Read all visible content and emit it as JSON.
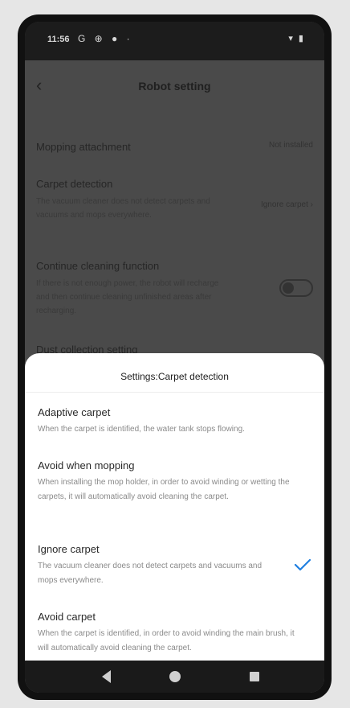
{
  "status_bar": {
    "time": "11:56",
    "left_icons": "G ⊕ ● ·",
    "right_icons": "▾ ▮"
  },
  "header": {
    "title": "Robot setting"
  },
  "background_rows": [
    {
      "title": "Mopping attachment",
      "value": "Not installed"
    },
    {
      "title": "Carpet detection",
      "desc": "The vacuum cleaner does not detect carpets and vacuums and mops everywhere.",
      "value": "Ignore carpet ›"
    },
    {
      "title": "Continue cleaning function",
      "desc": "If there is not enough power, the robot will recharge and then continue cleaning unfinished areas after recharging."
    },
    {
      "title": "Dust collection setting"
    }
  ],
  "sheet": {
    "title": "Settings:Carpet detection",
    "options": [
      {
        "title": "Adaptive carpet",
        "desc": "When the carpet is identified, the water tank stops flowing."
      },
      {
        "title": "Avoid when mopping",
        "desc": "When installing the mop holder, in order to avoid winding or wetting the carpets, it will automatically avoid cleaning the carpet."
      },
      {
        "title": "Ignore carpet",
        "desc": "The vacuum cleaner does not detect carpets and vacuums and mops everywhere.",
        "selected": true
      },
      {
        "title": "Avoid carpet",
        "desc": "When the carpet is identified, in order to avoid winding the main brush, it will automatically avoid cleaning the carpet."
      }
    ]
  },
  "colors": {
    "accent": "#1f7fe0",
    "overlay": "#474747",
    "sheet_bg": "#ffffff"
  },
  "icons": {
    "back": "chevron-left-icon",
    "check": "checkmark-icon",
    "nav": [
      "back-triangle-icon",
      "home-circle-icon",
      "recents-square-icon"
    ]
  }
}
